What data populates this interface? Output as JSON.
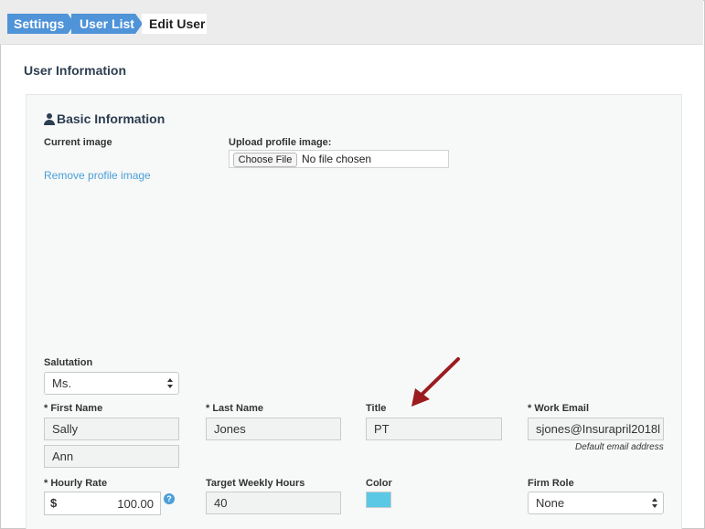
{
  "breadcrumb": {
    "items": [
      {
        "label": "Settings"
      },
      {
        "label": "User List"
      },
      {
        "label": "Edit User"
      }
    ]
  },
  "section": {
    "title": "User Information"
  },
  "basic_info": {
    "heading": "Basic Information",
    "icon": "user-icon",
    "current_image_label": "Current image",
    "remove_image_link": "Remove profile image",
    "upload_label": "Upload profile image:",
    "choose_file_label": "Choose File",
    "file_status": "No file chosen"
  },
  "form": {
    "salutation": {
      "label": "Salutation",
      "value": "Ms."
    },
    "first_name": {
      "label": "* First Name",
      "value": "Sally"
    },
    "middle_name": {
      "value": "Ann"
    },
    "last_name": {
      "label": "* Last Name",
      "value": "Jones"
    },
    "title": {
      "label": "Title",
      "value": "PT"
    },
    "work_email": {
      "label": "* Work Email",
      "value": "sjones@Insurapril2018l",
      "hint": "Default email address"
    },
    "hourly_rate": {
      "label": "* Hourly Rate",
      "currency": "$",
      "value": "100.00",
      "help_icon": "question-icon",
      "help_glyph": "?"
    },
    "target_weekly_hours": {
      "label": "Target Weekly Hours",
      "value": "40"
    },
    "color": {
      "label": "Color",
      "value": "#5bc8e6"
    },
    "firm_role": {
      "label": "Firm Role",
      "value": "None"
    }
  },
  "colors": {
    "breadcrumb_active": "#4f93d8",
    "link": "#4a9fd8",
    "annotation_arrow": "#9b1c1f"
  }
}
